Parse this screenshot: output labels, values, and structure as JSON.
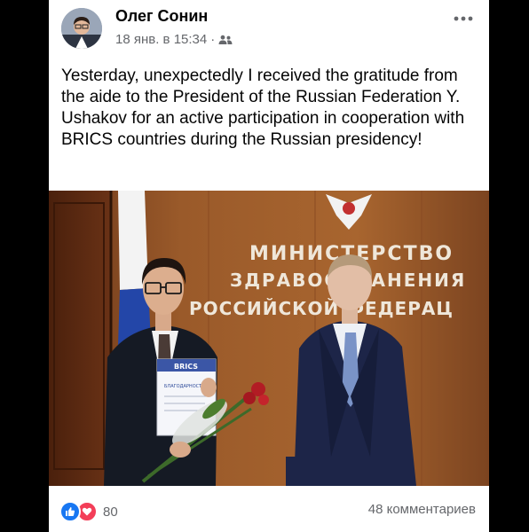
{
  "post": {
    "author": "Олег Сонин",
    "time": "18 янв. в 15:34",
    "separator": "·",
    "audience_icon": "friends-icon",
    "more_icon": "more-dots-icon",
    "text": "Yesterday, unexpectedly I received the gratitude from the aide to the President of the Russian Federation Y. Ushakov for an active participation in cooperation with BRICS countries during the Russian presidency!"
  },
  "photo": {
    "sign_lines": [
      "МИНИСТЕРСТВО",
      "ЗДРАВООХРАНЕНИЯ",
      "РОССИЙСКОЙ ФЕДЕРАЦ"
    ],
    "certificate_header": "BRICS",
    "certificate_title": "БЛАГОДАРНОСТЬ"
  },
  "footer": {
    "reaction_icons": [
      "like-icon",
      "love-icon"
    ],
    "reaction_count": "80",
    "comments": "48 комментариев"
  },
  "colors": {
    "like": "#1877f2",
    "love": "#f33e58",
    "meta_text": "#65676b",
    "background": "#000000"
  }
}
